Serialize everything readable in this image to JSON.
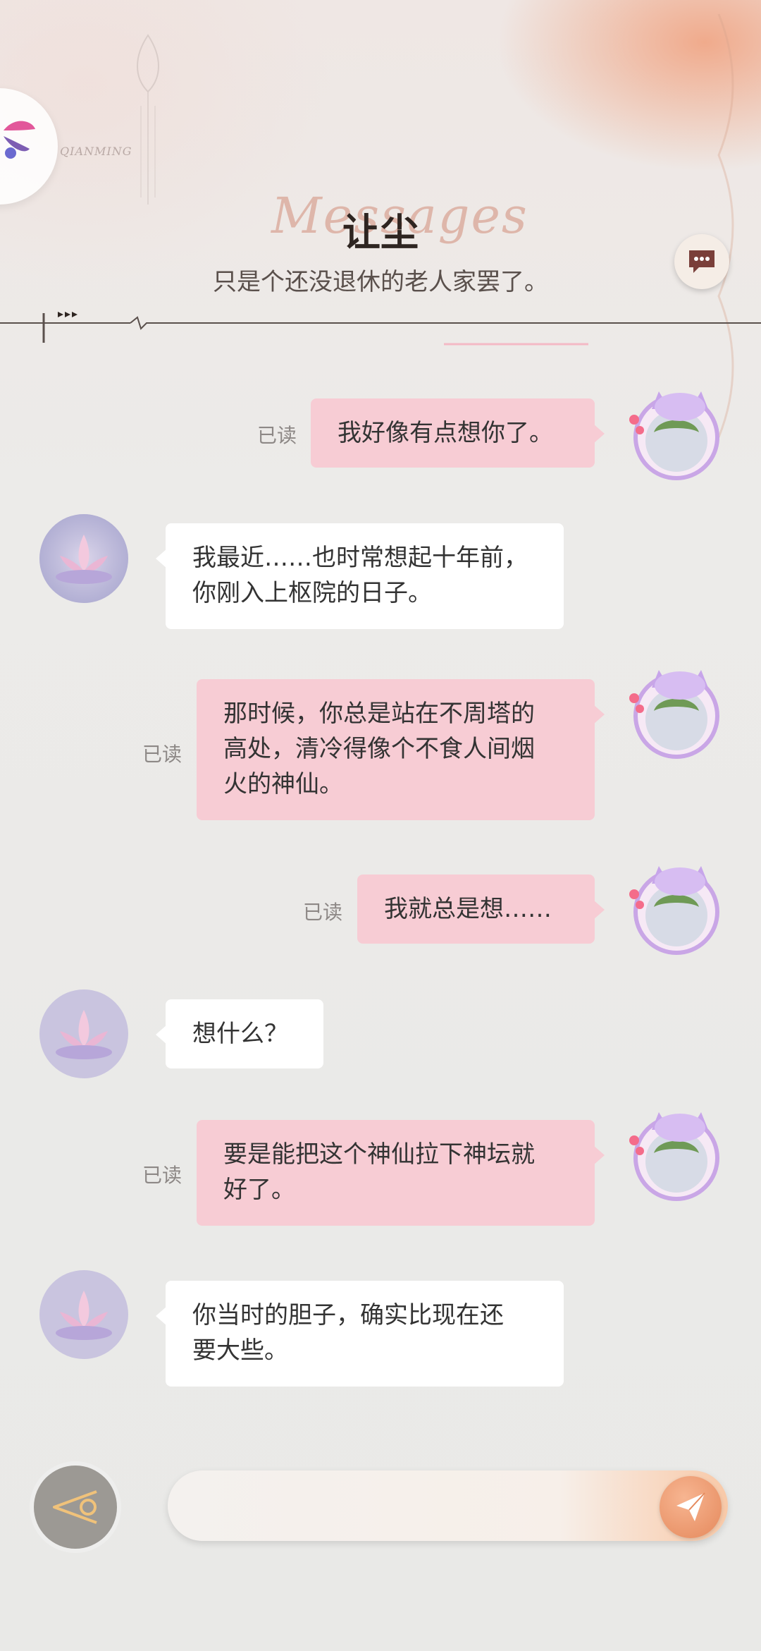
{
  "header": {
    "title": "让尘",
    "title_script": "Messages",
    "subtitle": "只是个还没退休的老人家罢了。",
    "logo_text": "QIANMING"
  },
  "messages": [
    {
      "side": "me",
      "lines": [
        "我好像有点想你了。"
      ],
      "read": "已读"
    },
    {
      "side": "other",
      "lines": [
        "我最近……也时常想起十年前，",
        "你刚入上枢院的日子。"
      ]
    },
    {
      "side": "me",
      "lines": [
        "那时候，你总是站在不周塔的",
        "高处，清冷得像个不食人间烟",
        "火的神仙。"
      ],
      "read": "已读"
    },
    {
      "side": "me",
      "lines": [
        "我就总是想……"
      ],
      "read": "已读"
    },
    {
      "side": "other",
      "lines": [
        "想什么？"
      ]
    },
    {
      "side": "me",
      "lines": [
        "要是能把这个神仙拉下神坛就",
        "好了。"
      ],
      "read": "已读"
    },
    {
      "side": "other",
      "lines": [
        "你当时的胆子，确实比现在还",
        "要大些。"
      ]
    }
  ],
  "composer": {
    "value": "",
    "placeholder": ""
  },
  "icons": {
    "chat": "speech-bubble-icon",
    "back": "back-triangle-icon",
    "send": "paper-plane-icon"
  },
  "colors": {
    "my_bubble": "#f7ccd4",
    "their_bubble": "#ffffff",
    "accent": "#e5895c"
  }
}
